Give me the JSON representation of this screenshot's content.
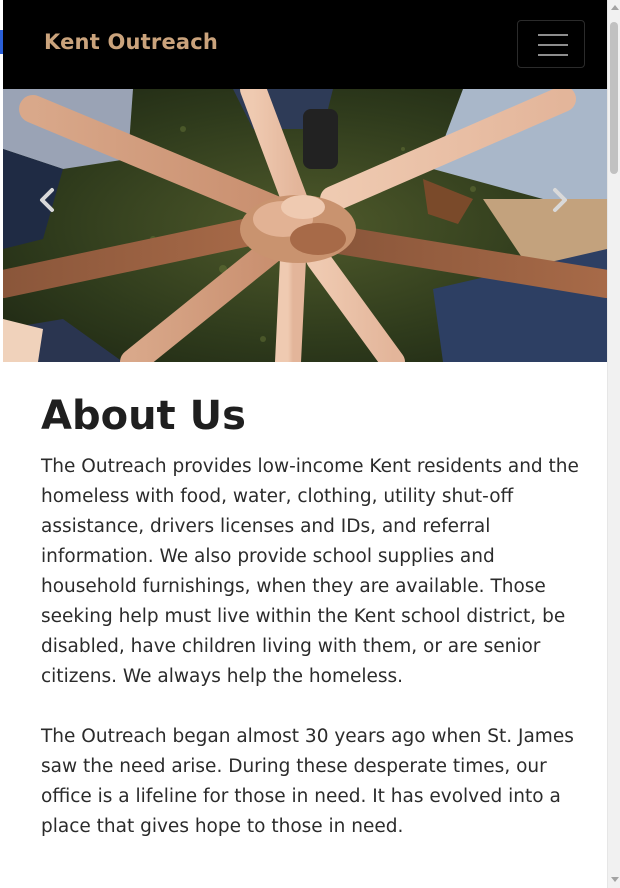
{
  "navbar": {
    "brand": "Kent Outreach"
  },
  "carousel": {
    "prev_icon": "chevron-left-icon",
    "next_icon": "chevron-right-icon",
    "image": "hands-together-photo"
  },
  "about": {
    "title": "About Us",
    "paragraphs": [
      "The Outreach provides low-income Kent residents and the homeless with food, water, clothing, utility shut-off assistance, drivers licenses and IDs, and referral information. We also provide school supplies and household furnishings, when they are available. Those seeking help must live within the Kent school district, be disabled, have children living with them, or are senior citizens. We always help the homeless.",
      "The Outreach began almost 30 years ago when St. James saw the need arise. During these desperate times, our office is a lifeline for those in need. It has evolved into a place that gives hope to those in need."
    ]
  },
  "colors": {
    "brand": "#caa37c",
    "navbar_bg": "#000000",
    "text": "#2b2b2b"
  }
}
